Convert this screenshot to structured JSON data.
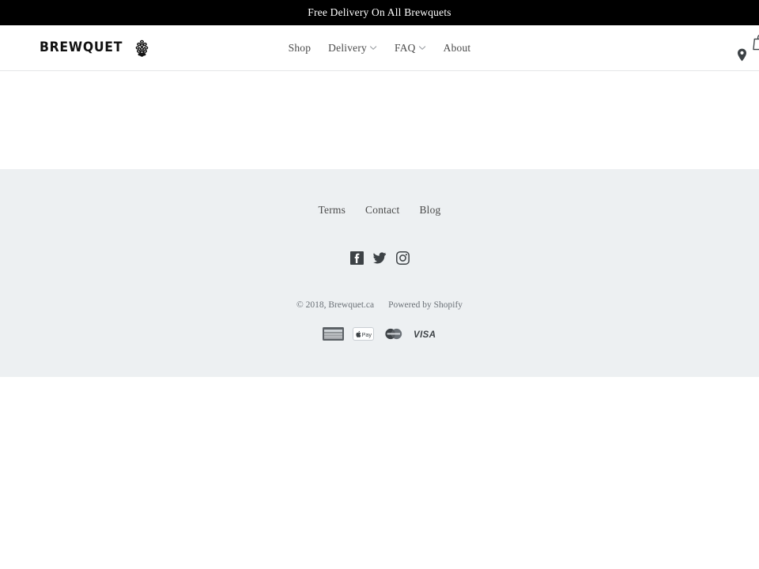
{
  "announcement": {
    "text": "Free Delivery On All Brewquets",
    "background": "#000000",
    "color": "#ffffff"
  },
  "header": {
    "logo_text": "BREWQUET",
    "logo_icon": "hop-cone-icon",
    "nav": [
      {
        "label": "Shop",
        "has_dropdown": false
      },
      {
        "label": "Delivery",
        "has_dropdown": true
      },
      {
        "label": "FAQ",
        "has_dropdown": true
      },
      {
        "label": "About",
        "has_dropdown": false
      }
    ],
    "actions": {
      "location_icon": "location-pin-icon",
      "cart_icon": "shopping-bag-icon"
    },
    "border_color": "#e4e6e8"
  },
  "footer": {
    "background": "#edf0f2",
    "links": [
      {
        "label": "Terms"
      },
      {
        "label": "Contact"
      },
      {
        "label": "Blog"
      }
    ],
    "social": [
      {
        "name": "facebook-icon"
      },
      {
        "name": "twitter-icon"
      },
      {
        "name": "instagram-icon"
      }
    ],
    "copyright": "© 2018, Brewquet.ca",
    "powered_by": "Powered by Shopify",
    "payments": [
      {
        "name": "american-express-icon",
        "label": "AMERICAN EXPRESS"
      },
      {
        "name": "apple-pay-icon",
        "label": "Pay"
      },
      {
        "name": "mastercard-icon",
        "label": "MasterCard"
      },
      {
        "name": "visa-icon",
        "label": "VISA"
      }
    ]
  }
}
